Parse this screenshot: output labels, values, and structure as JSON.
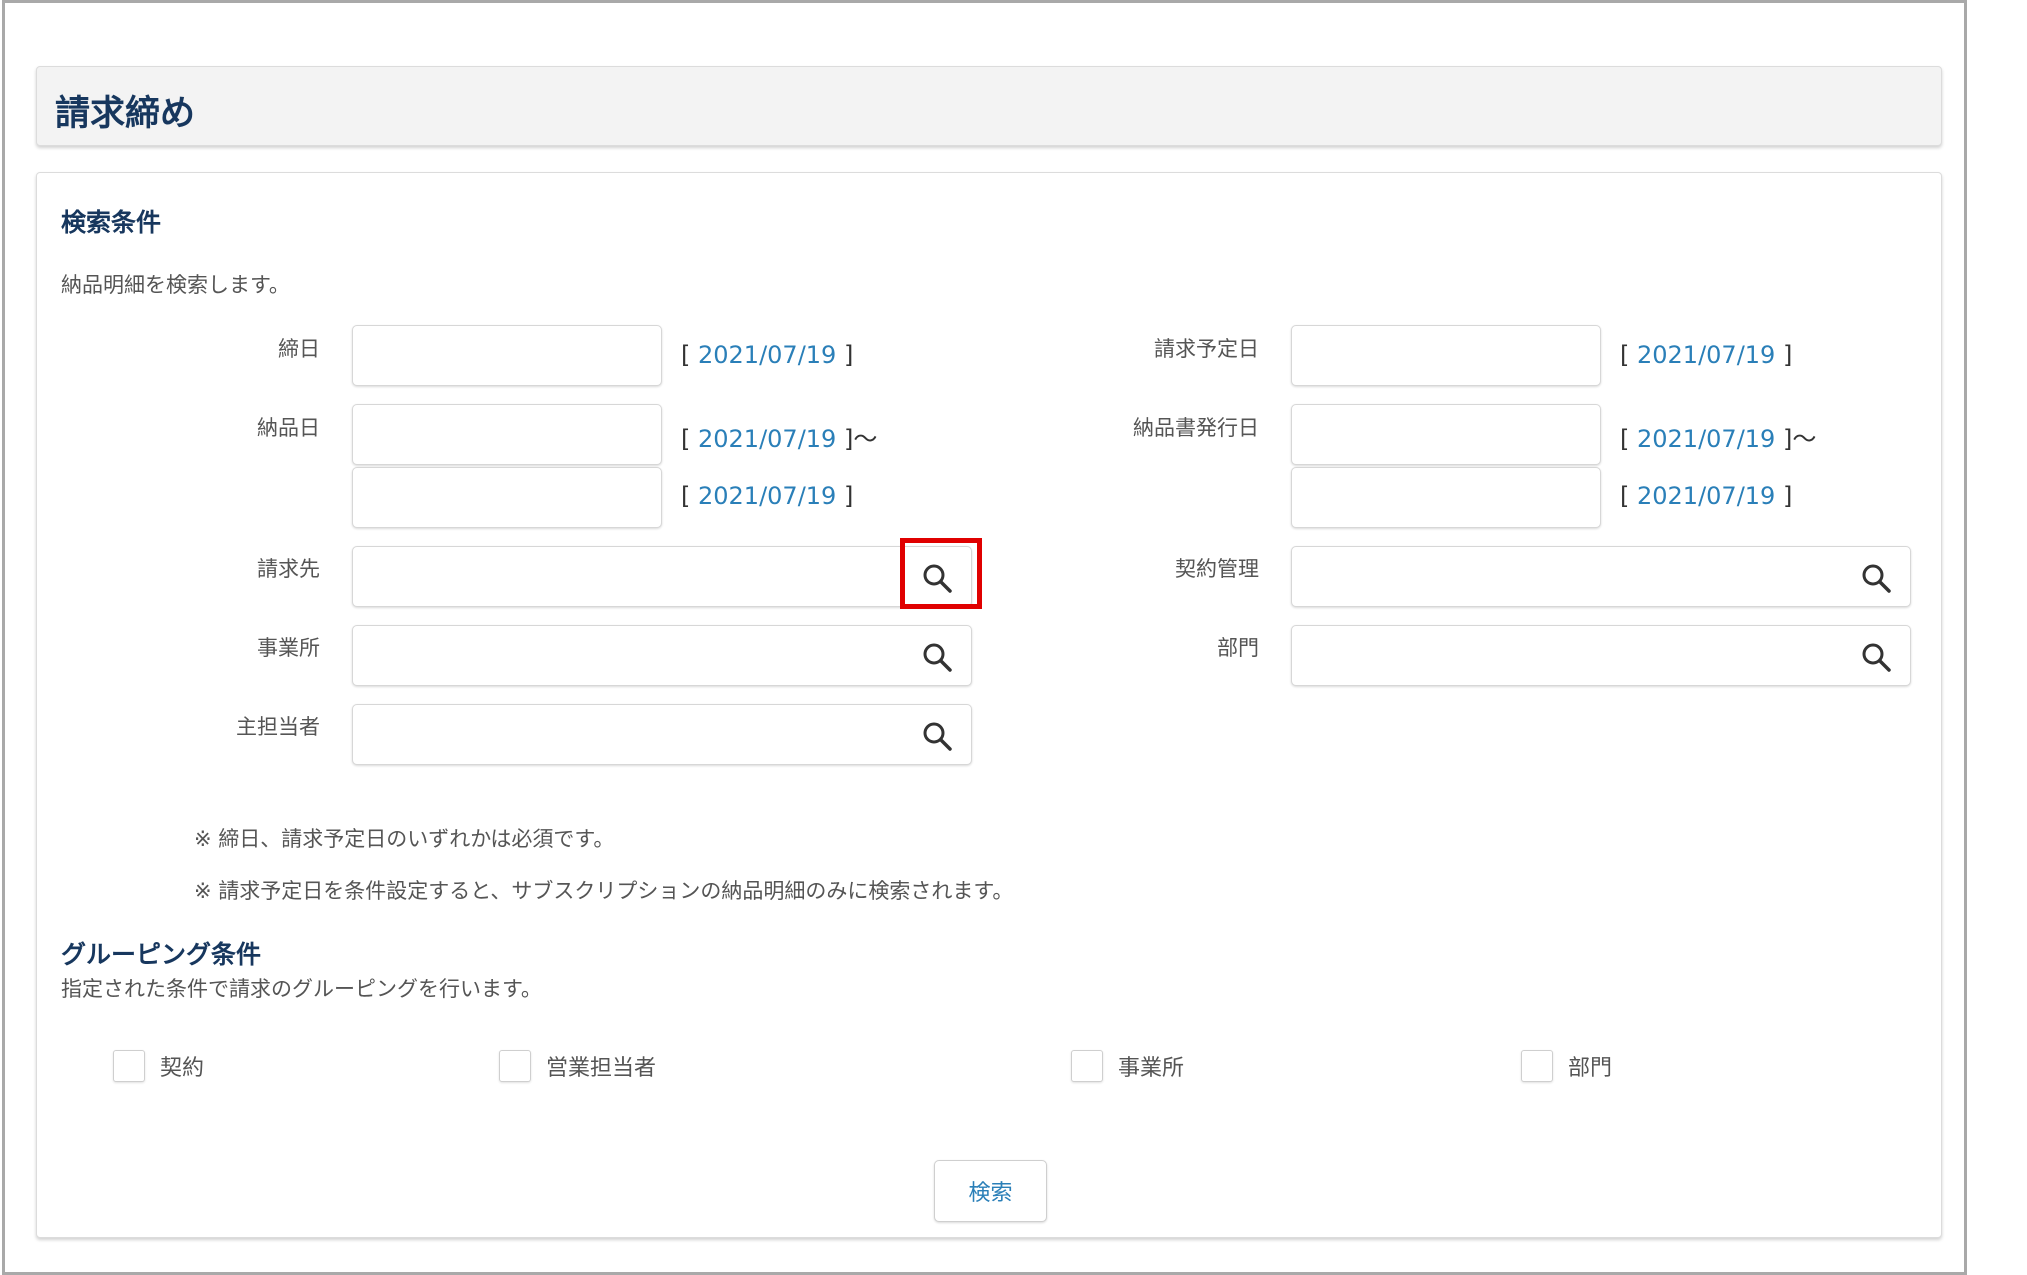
{
  "page": {
    "title": "請求締め"
  },
  "search_conditions": {
    "heading": "検索条件",
    "description": "納品明細を検索します。",
    "fields": {
      "closing_date": {
        "label": "締日",
        "value": "",
        "today_link": "2021/07/19"
      },
      "billing_scheduled_date": {
        "label": "請求予定日",
        "value": "",
        "today_link": "2021/07/19"
      },
      "delivery_date": {
        "label": "納品日",
        "from_value": "",
        "to_value": "",
        "from_today_link": "2021/07/19",
        "to_today_link": "2021/07/19",
        "range_separator": "〜"
      },
      "delivery_note_issue_date": {
        "label": "納品書発行日",
        "from_value": "",
        "to_value": "",
        "from_today_link": "2021/07/19",
        "to_today_link": "2021/07/19",
        "range_separator": "〜"
      },
      "billing_destination": {
        "label": "請求先",
        "value": ""
      },
      "contract_management": {
        "label": "契約管理",
        "value": ""
      },
      "business_office": {
        "label": "事業所",
        "value": ""
      },
      "department": {
        "label": "部門",
        "value": ""
      },
      "primary_person": {
        "label": "主担当者",
        "value": ""
      }
    },
    "notes": [
      "※ 締日、請求予定日のいずれかは必須です。",
      "※ 請求予定日を条件設定すると、サブスクリプションの納品明細のみに検索されます。"
    ]
  },
  "grouping_conditions": {
    "heading": "グルーピング条件",
    "description": "指定された条件で請求のグルーピングを行います。",
    "options": [
      {
        "label": "契約",
        "checked": false
      },
      {
        "label": "営業担当者",
        "checked": false
      },
      {
        "label": "事業所",
        "checked": false
      },
      {
        "label": "部門",
        "checked": false
      }
    ]
  },
  "actions": {
    "search_label": "検索"
  },
  "colors": {
    "title": "#17375e",
    "link": "#2a7fb8",
    "highlight": "#e00000"
  },
  "icons": {
    "lookup": "search-icon"
  }
}
